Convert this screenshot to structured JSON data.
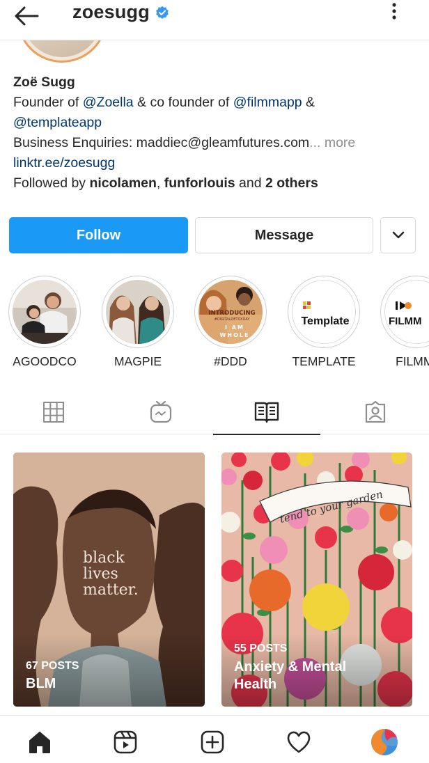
{
  "header": {
    "username": "zoesugg",
    "verified": true,
    "accent_color": "#3897f0"
  },
  "bio": {
    "name": "Zoë Sugg",
    "line1_prefix": "Founder of ",
    "line1_mention1": "@Zoella",
    "line1_middle": " & co founder of ",
    "line1_mention2": "@filmmapp",
    "line1_suffix": " &",
    "line2_mention": "@templateapp",
    "line3_text": "Business Enquiries: maddiec@gleamfutures.com",
    "line3_more": "... more",
    "website": "linktr.ee/zoesugg",
    "followed_prefix": "Followed by ",
    "followed_user1": "nicolamen",
    "followed_sep": ", ",
    "followed_user2": "funforlouis",
    "followed_and": " and ",
    "followed_others": "2 others"
  },
  "actions": {
    "follow_label": "Follow",
    "message_label": "Message",
    "follow_color": "#1a9af5"
  },
  "highlights": [
    {
      "label": "AGOODCO"
    },
    {
      "label": "MAGPIE"
    },
    {
      "label": "#DDD",
      "cover_text_1": "INTRODUCING",
      "cover_text_2": "#DIGITALDETOXDAY",
      "cover_text_3": "I AM",
      "cover_text_4": "WHOLE"
    },
    {
      "label": "TEMPLATE",
      "cover_text": "Template"
    },
    {
      "label": "FILMM",
      "cover_text": "FILMM"
    }
  ],
  "tabs": [
    {
      "name": "grid",
      "icon": "grid-icon"
    },
    {
      "name": "igtv",
      "icon": "igtv-icon"
    },
    {
      "name": "guides",
      "icon": "guide-icon",
      "active": true
    },
    {
      "name": "tagged",
      "icon": "tagged-icon"
    }
  ],
  "guides": [
    {
      "count": "67 POSTS",
      "title": "BLM",
      "cover_text_1": "black",
      "cover_text_2": "lives",
      "cover_text_3": "matter."
    },
    {
      "count": "55 POSTS",
      "title_line1": "Anxiety & Mental",
      "title_line2": "Health",
      "cover_text": "tend to your garden"
    }
  ],
  "bottom_nav": [
    {
      "name": "home",
      "icon": "home-icon",
      "active": true
    },
    {
      "name": "reels",
      "icon": "reels-icon"
    },
    {
      "name": "create",
      "icon": "create-icon"
    },
    {
      "name": "activity",
      "icon": "heart-icon"
    },
    {
      "name": "profile",
      "icon": "avatar-icon"
    }
  ]
}
